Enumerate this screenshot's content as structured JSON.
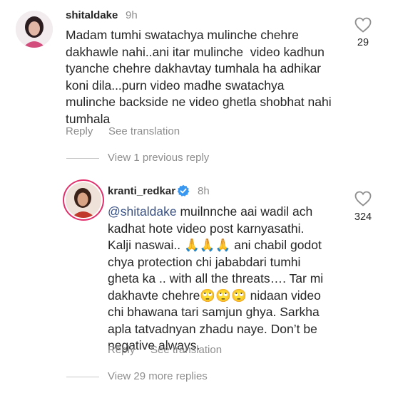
{
  "comment1": {
    "username": "shitaldake",
    "time": "9h",
    "text": "Madam tumhi swatachya mulinche chehre\ndakhawle nahi..ani itar mulinche  video kadhun\ntyanche chehre dakhavtay tumhala ha adhikar\nkoni dila...purn video madhe swatachya\nmulinche backside ne video ghetla shobhat nahi\ntumhala",
    "likes": "29",
    "reply_label": "Reply",
    "translate_label": "See translation"
  },
  "view_previous": "View 1 previous reply",
  "reply1": {
    "username": "kranti_redkar",
    "time": "8h",
    "mention": "@shitaldake",
    "text": " muilnnche aai wadil ach\nkadhat hote video post karnyasathi.\nKalji naswai.. 🙏🙏🙏 ani chabil godot\nchya protection chi jababdari tumhi\ngheta ka .. with all the threats…. Tar mi\ndakhavte chehre🙄🙄🙄 nidaan video\nchi bhawana tari samjun ghya. Sarkha\napla tatvadnyan zhadu naye. Don’t be\nnegative always.",
    "likes": "324",
    "reply_label": "Reply",
    "translate_label": "See translation"
  },
  "view_more": "View 29 more replies",
  "colors": {
    "verified": "#3897f0",
    "secondary": "#8e8e8e",
    "primary": "#262626"
  }
}
